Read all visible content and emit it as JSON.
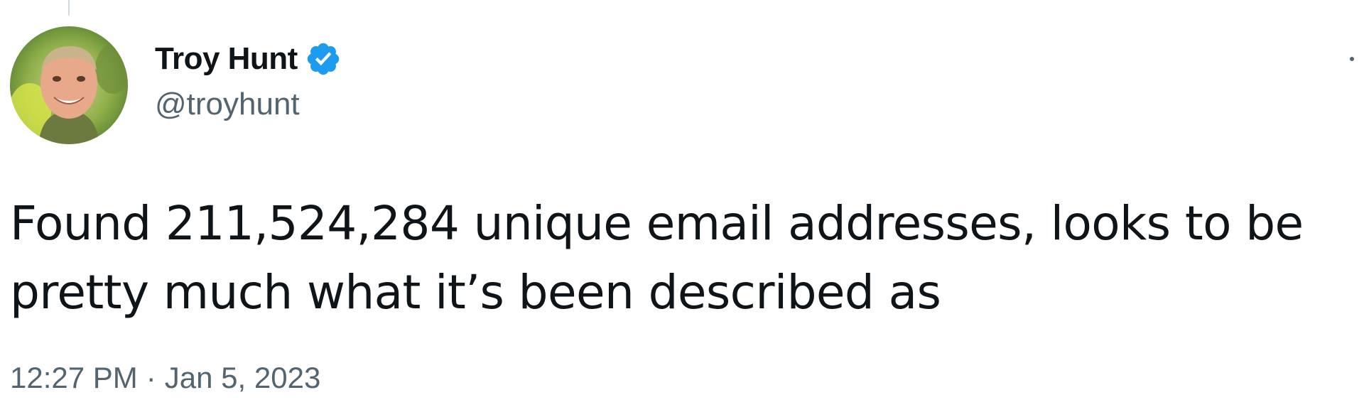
{
  "tweet": {
    "author": {
      "display_name": "Troy Hunt",
      "handle": "@troyhunt",
      "verified": true,
      "avatar_icon": "profile-photo"
    },
    "text": "Found 211,524,284 unique email addresses, looks to be pretty much what it’s been described as",
    "time": "12:27 PM",
    "separator": "·",
    "date": "Jan 5, 2023"
  },
  "colors": {
    "text_primary": "#0f1419",
    "text_secondary": "#536471",
    "verified_blue": "#1d9bf0",
    "background": "#ffffff"
  },
  "icons": {
    "verified": "verified-badge-icon",
    "more": "more-options-icon"
  }
}
